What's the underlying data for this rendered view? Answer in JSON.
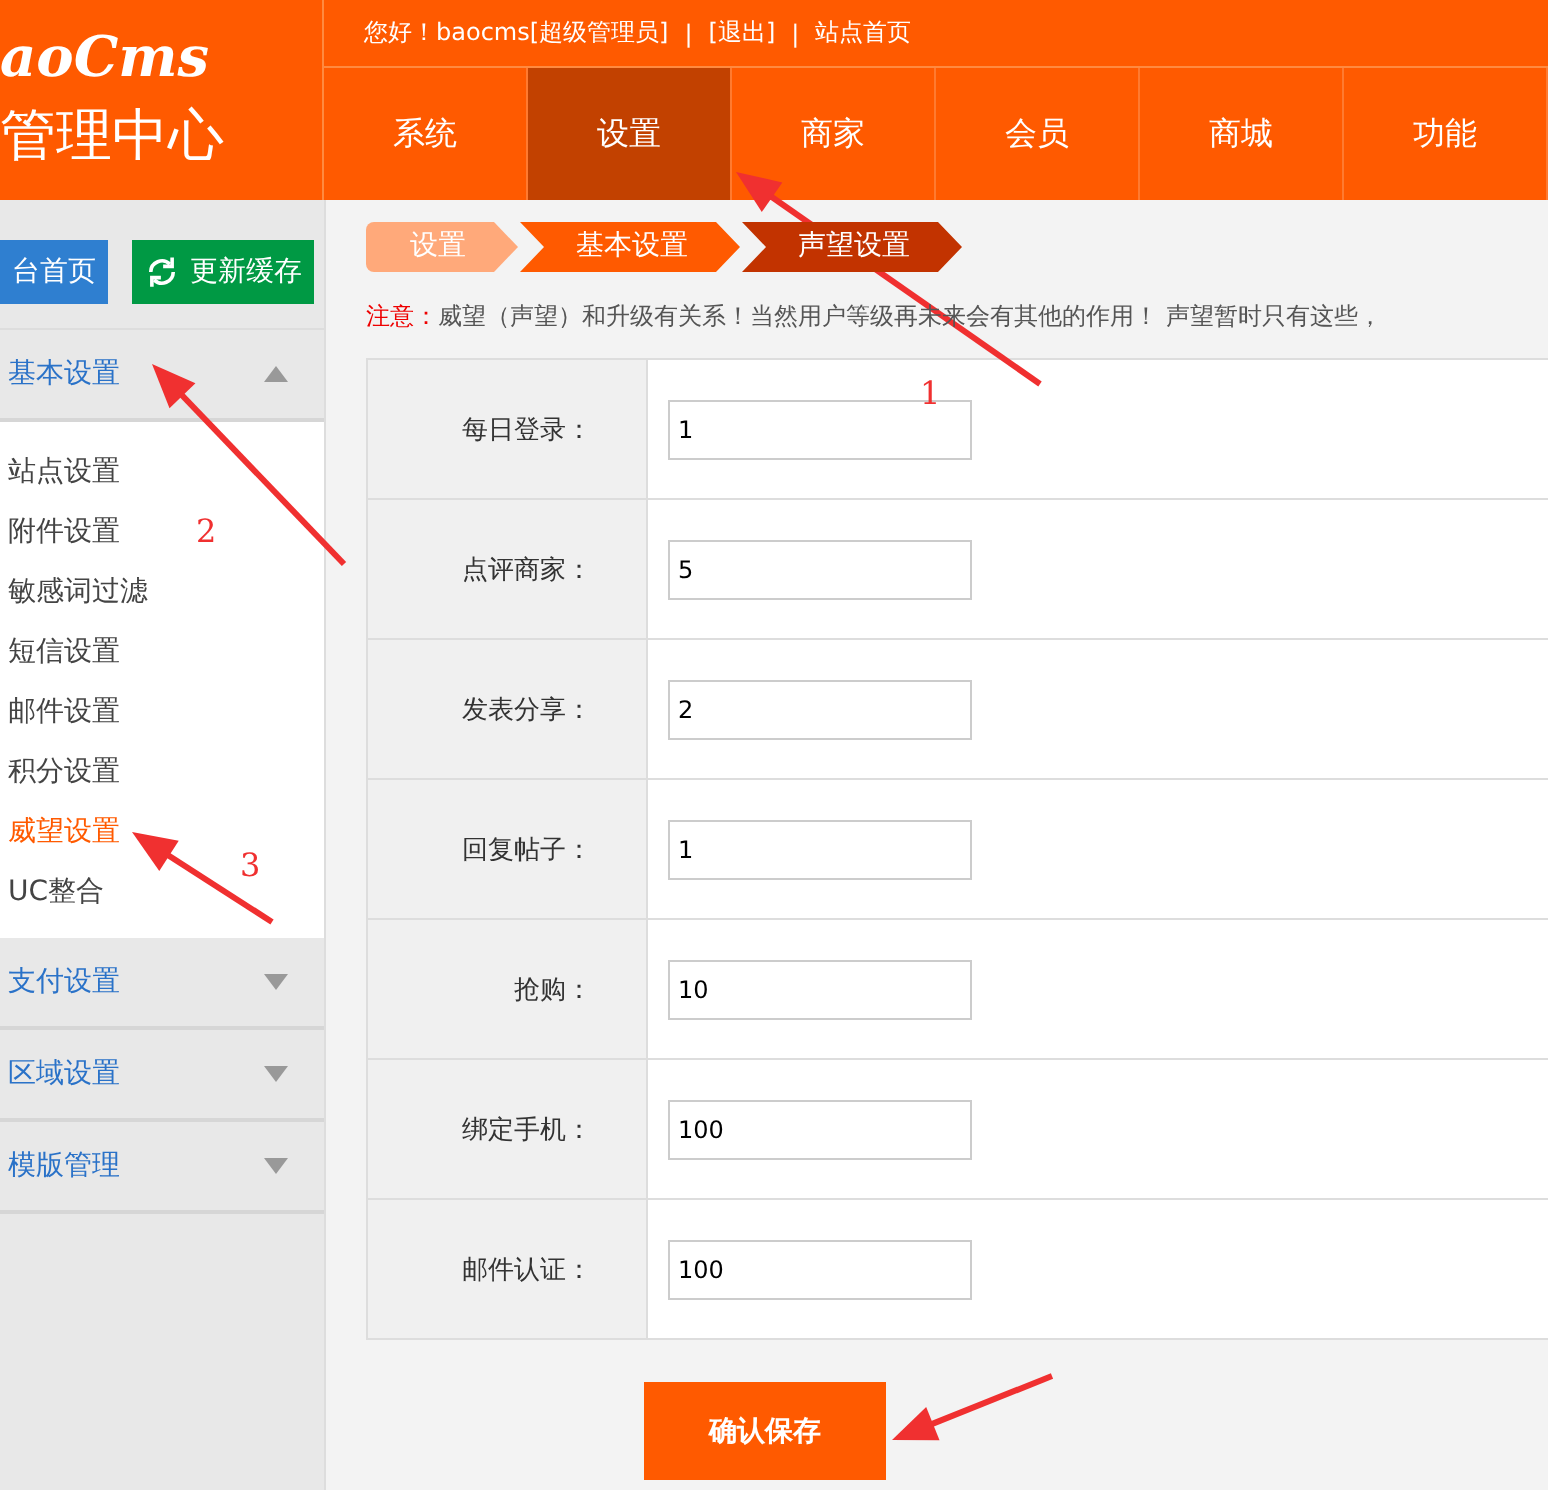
{
  "logo": {
    "brand": "aoCms",
    "subtitle": "管理中心"
  },
  "topbar": {
    "greeting": "您好！baocms[超级管理员]",
    "separator": "|",
    "links": [
      "[退出]",
      "站点首页"
    ]
  },
  "nav": [
    {
      "label": "系统",
      "selected": false
    },
    {
      "label": "设置",
      "selected": true
    },
    {
      "label": "商家",
      "selected": false
    },
    {
      "label": "会员",
      "selected": false
    },
    {
      "label": "商城",
      "selected": false
    },
    {
      "label": "功能",
      "selected": false
    }
  ],
  "sidebar": {
    "buttons": [
      {
        "label": "台首页",
        "kind": "home"
      },
      {
        "label": "更新缓存",
        "kind": "refresh"
      }
    ],
    "groups": [
      {
        "label": "基本设置",
        "expanded": true,
        "children": [
          {
            "label": "站点设置",
            "selected": false
          },
          {
            "label": "附件设置",
            "selected": false
          },
          {
            "label": "敏感词过滤",
            "selected": false
          },
          {
            "label": "短信设置",
            "selected": false
          },
          {
            "label": "邮件设置",
            "selected": false
          },
          {
            "label": "积分设置",
            "selected": false
          },
          {
            "label": "威望设置",
            "selected": true
          },
          {
            "label": "UC整合",
            "selected": false
          }
        ]
      },
      {
        "label": "支付设置",
        "expanded": false
      },
      {
        "label": "区域设置",
        "expanded": false
      },
      {
        "label": "模版管理",
        "expanded": false
      }
    ]
  },
  "breadcrumb": [
    "设置",
    "基本设置",
    "声望设置"
  ],
  "notice": {
    "label": "注意：",
    "text": "威望（声望）和升级有关系！当然用户等级再未来会有其他的作用！  声望暂时只有这些，"
  },
  "form": [
    {
      "label": "每日登录：",
      "value": "1"
    },
    {
      "label": "点评商家：",
      "value": "5"
    },
    {
      "label": "发表分享：",
      "value": "2"
    },
    {
      "label": "回复帖子：",
      "value": "1"
    },
    {
      "label": "抢购：",
      "value": "10"
    },
    {
      "label": "绑定手机：",
      "value": "100"
    },
    {
      "label": "邮件认证：",
      "value": "100"
    }
  ],
  "save_button": "确认保存",
  "annotations": [
    {
      "kind": "numbered",
      "label": "1"
    },
    {
      "kind": "numbered",
      "label": "2"
    },
    {
      "kind": "numbered",
      "label": "3"
    },
    {
      "kind": "plain"
    }
  ]
}
